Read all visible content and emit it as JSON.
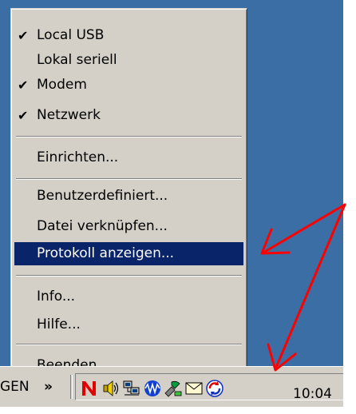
{
  "menu": {
    "items": [
      {
        "label": "Local USB",
        "checked": "✔"
      },
      {
        "label": "Lokal seriell",
        "checked": ""
      },
      {
        "label": "Modem",
        "checked": "✔"
      },
      {
        "label": "Netzwerk",
        "checked": "✔"
      },
      {
        "label": "Einrichten...",
        "checked": ""
      },
      {
        "label": "Benutzerdefiniert...",
        "checked": ""
      },
      {
        "label": "Datei verknüpfen...",
        "checked": ""
      },
      {
        "label": "Protokoll anzeigen...",
        "checked": ""
      },
      {
        "label": "Info...",
        "checked": ""
      },
      {
        "label": "Hilfe...",
        "checked": ""
      },
      {
        "label": "Beenden",
        "checked": ""
      }
    ],
    "highlighted_item": "Protokoll anzeigen..."
  },
  "taskbar": {
    "left_text": "GEN",
    "chevron": "»",
    "clock": "10:04",
    "tray_icons": [
      "norton-icon",
      "speaker-icon",
      "network-icon",
      "wave-icon",
      "tools-icon",
      "mail-icon",
      "sync-icon"
    ]
  },
  "colors": {
    "desktop": "#3a6ea5",
    "menu_bg": "#d4d0c8",
    "highlight": "#0a246a",
    "annotation": "#ff0000"
  }
}
